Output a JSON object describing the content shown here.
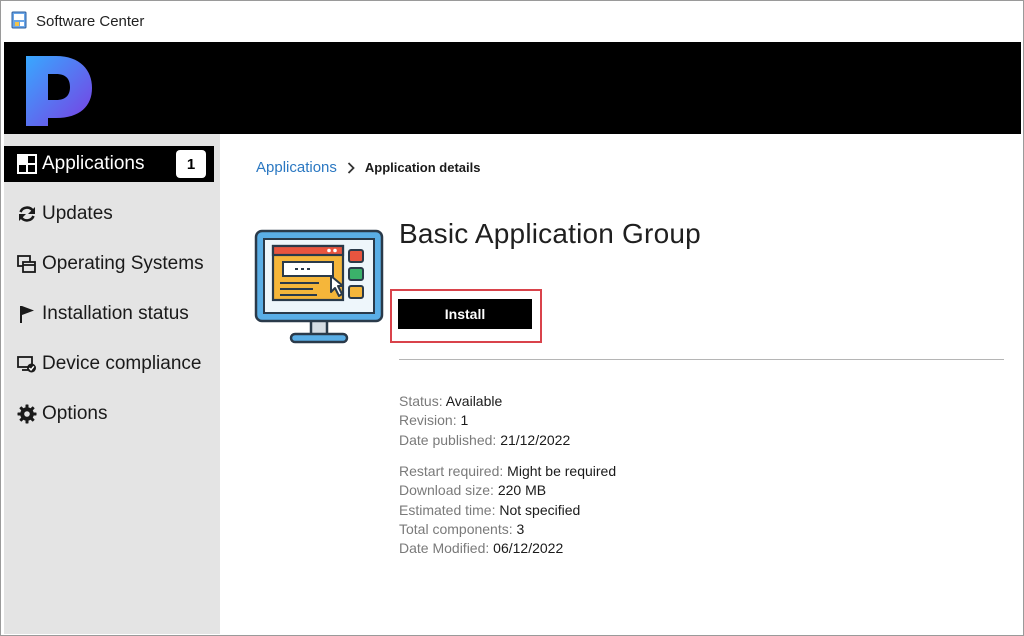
{
  "window": {
    "title": "Software Center",
    "app_icon": "software-center-icon"
  },
  "banner": {
    "logo": "prajwal-p-logo",
    "logo_gradient": [
      "#3aa0ff",
      "#7b3fe4"
    ]
  },
  "sidebar": {
    "items": [
      {
        "label": "Applications",
        "icon": "applications-grid-icon",
        "active": true,
        "badge": "1"
      },
      {
        "label": "Updates",
        "icon": "refresh-icon"
      },
      {
        "label": "Operating Systems",
        "icon": "windows-stack-icon"
      },
      {
        "label": "Installation status",
        "icon": "flag-icon"
      },
      {
        "label": "Device compliance",
        "icon": "device-check-icon"
      },
      {
        "label": "Options",
        "icon": "gear-icon"
      }
    ]
  },
  "breadcrumb": {
    "link": "Applications",
    "current": "Application details"
  },
  "app": {
    "name": "Basic Application Group",
    "icon": "monitor-app-icon",
    "install_label": "Install"
  },
  "details": {
    "group1": [
      {
        "key": "Status:",
        "value": "Available"
      },
      {
        "key": "Revision:",
        "value": "1"
      },
      {
        "key": "Date published:",
        "value": "21/12/2022"
      }
    ],
    "group2": [
      {
        "key": "Restart required:",
        "value": "Might be required"
      },
      {
        "key": "Download size:",
        "value": "220 MB"
      },
      {
        "key": "Estimated time:",
        "value": "Not specified"
      },
      {
        "key": "Total components:",
        "value": "3"
      },
      {
        "key": "Date Modified:",
        "value": "06/12/2022"
      }
    ]
  },
  "colors": {
    "accent_link": "#2b78c2",
    "highlight_border": "#d9434b",
    "sidebar_bg": "#e4e4e4",
    "banner_bg": "#000000"
  }
}
